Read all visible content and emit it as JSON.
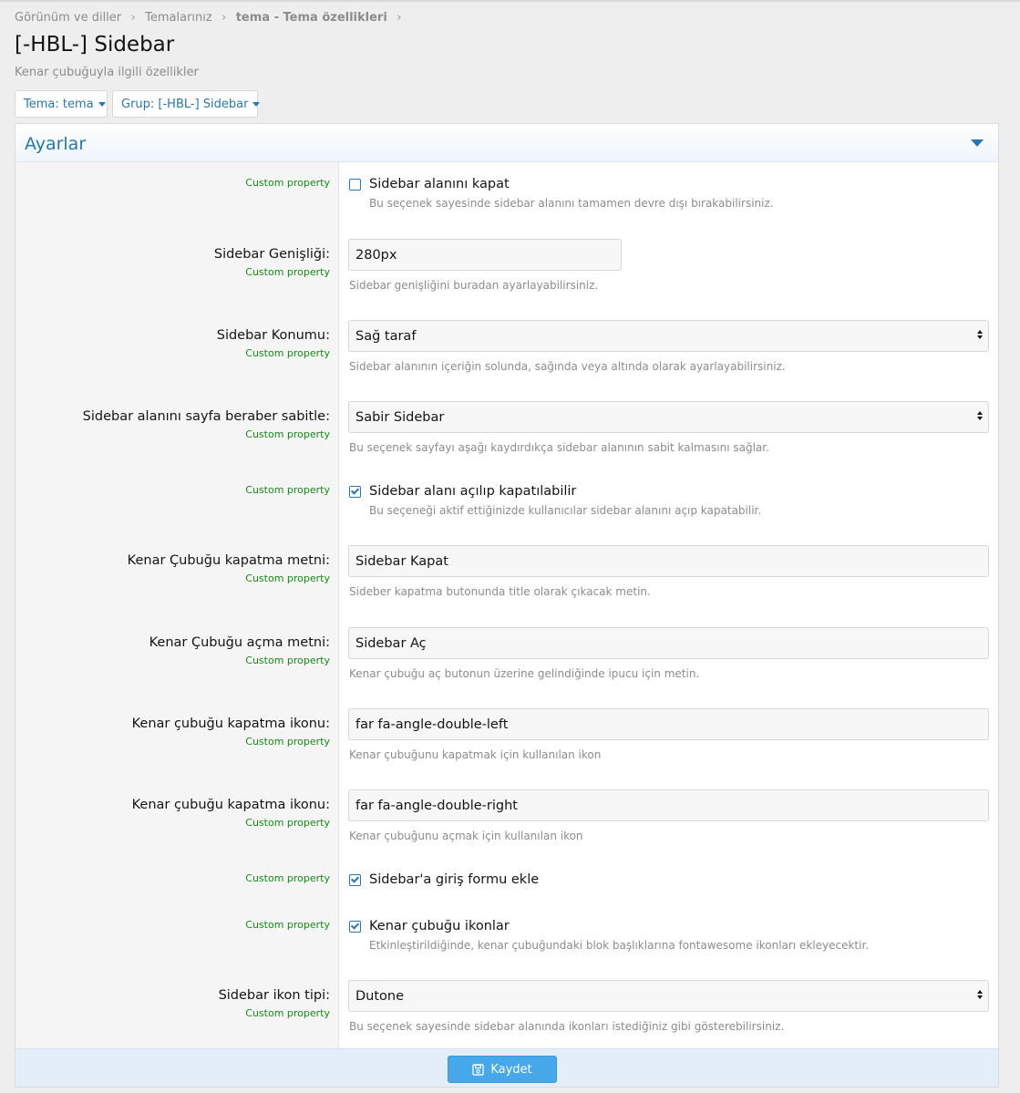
{
  "breadcrumb": {
    "items": [
      "Görünüm ve diller",
      "Temalarınız"
    ],
    "current_bold": "tema",
    "current_rest": " - Tema özellikleri"
  },
  "page": {
    "title": "[-HBL-] Sidebar",
    "description": "Kenar çubuğuyla ilgili özellikler"
  },
  "filters": {
    "theme": "Tema: tema",
    "group": "Grup: [-HBL-] Sidebar"
  },
  "block": {
    "title": "Ayarlar"
  },
  "custom_property": "Custom property",
  "settings": [
    {
      "type": "checkbox",
      "label": "Sidebar alanını kapat",
      "checked": false,
      "hint": "Bu seçenek sayesinde sidebar alanını tamamen devre dışı bırakabilirsiniz."
    },
    {
      "type": "text",
      "label": "Sidebar Genişliği:",
      "value": "280px",
      "hint": "Sidebar genişliğini buradan ayarlayabilirsiniz."
    },
    {
      "type": "select",
      "label": "Sidebar Konumu:",
      "value": "Sağ taraf",
      "hint": "Sidebar alanının içeriğin solunda, sağında veya altında olarak ayarlayabilirsiniz."
    },
    {
      "type": "select",
      "label": "Sidebar alanını sayfa beraber sabitle:",
      "value": "Sabir Sidebar",
      "hint": "Bu seçenek sayfayı aşağı kaydırdıkça sidebar alanının sabit kalmasını sağlar."
    },
    {
      "type": "checkbox",
      "label": "Sidebar alanı açılıp kapatılabilir",
      "checked": true,
      "hint": "Bu seçeneği aktif ettiğinizde kullanıcılar sidebar alanını açıp kapatabilir."
    },
    {
      "type": "text",
      "label": "Kenar Çubuğu kapatma metni:",
      "value": "Sidebar Kapat",
      "hint": "Sideber kapatma butonunda title olarak çıkacak metin."
    },
    {
      "type": "text",
      "label": "Kenar Çubuğu açma metni:",
      "value": "Sidebar Aç",
      "hint": "Kenar çubuğu aç butonun üzerine gelindiğinde ipucu için metin."
    },
    {
      "type": "text",
      "label": "Kenar çubuğu kapatma ikonu:",
      "value": "far fa-angle-double-left",
      "hint": "Kenar çubuğunu kapatmak için kullanılan ikon"
    },
    {
      "type": "text",
      "label": "Kenar çubuğu kapatma ikonu:",
      "value": "far fa-angle-double-right",
      "hint": "Kenar çubuğunu açmak için kullanılan ikon"
    },
    {
      "type": "checkbox",
      "label": "Sidebar'a giriş formu ekle",
      "checked": true,
      "hint": ""
    },
    {
      "type": "checkbox",
      "label": "Kenar çubuğu ikonlar",
      "checked": true,
      "hint": "Etkinleştirildiğinde, kenar çubuğundaki blok başlıklarına fontawesome ikonları ekleyecektir."
    },
    {
      "type": "select",
      "label": "Sidebar ikon tipi:",
      "value": "Dutone",
      "hint": "Bu seçenek sayesinde sidebar alanında ikonları istediğiniz gibi gösterebilirsiniz."
    }
  ],
  "footer": {
    "save_label": "Kaydet"
  },
  "colors": {
    "accent": "#2577b1",
    "custom_property": "#168b16",
    "save_button": "#47a7eb"
  }
}
